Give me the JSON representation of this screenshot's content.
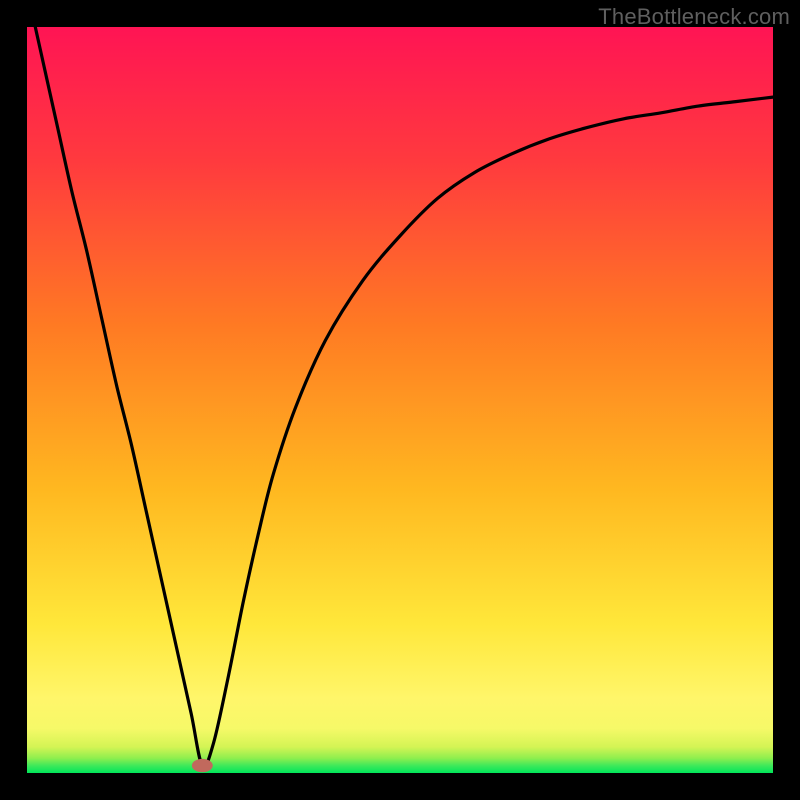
{
  "watermark": "TheBottleneck.com",
  "colors": {
    "bg": "#000000",
    "curve": "#000000",
    "marker_fill": "#c1695d",
    "green": "#00e65a",
    "yellow": "#ffe73a",
    "orange": "#ff9a1f",
    "red_top": "#ff1454",
    "red_mid": "#ff4a2f"
  },
  "chart_data": {
    "type": "line",
    "title": "",
    "xlabel": "",
    "ylabel": "",
    "xlim": [
      0,
      100
    ],
    "ylim": [
      0,
      100
    ],
    "series": [
      {
        "name": "bottleneck-curve",
        "x": [
          0,
          2,
          4,
          6,
          8,
          10,
          12,
          14,
          16,
          18,
          20,
          22,
          23.5,
          25,
          27,
          29,
          31,
          33,
          36,
          40,
          45,
          50,
          55,
          60,
          65,
          70,
          75,
          80,
          85,
          90,
          95,
          100
        ],
        "y": [
          105,
          96,
          87,
          78,
          70,
          61,
          52,
          44,
          35,
          26,
          17,
          8,
          1,
          4,
          13,
          23,
          32,
          40,
          49,
          58,
          66,
          72,
          77,
          80.5,
          83,
          85,
          86.5,
          87.7,
          88.5,
          89.4,
          90,
          90.6
        ]
      }
    ],
    "marker": {
      "x": 23.5,
      "y": 1,
      "rx": 1.4,
      "ry": 0.9
    },
    "gradient_bands": [
      {
        "y0": 0,
        "y1": 1.2,
        "color": "#00e65a"
      },
      {
        "y0": 1.2,
        "y1": 3,
        "color": "#9bee4c"
      },
      {
        "y0": 3,
        "y1": 6,
        "color": "#e2f247"
      },
      {
        "y0": 6,
        "y1": 12,
        "color": "#fff04a"
      },
      {
        "y0": 12,
        "y1": 100,
        "color": "gradient"
      }
    ]
  }
}
